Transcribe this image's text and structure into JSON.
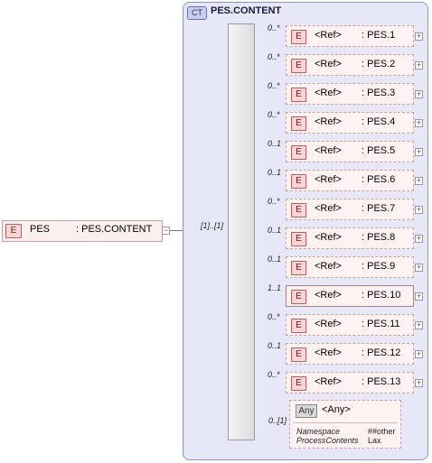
{
  "complex_type": {
    "badge": "CT",
    "name": "PES.CONTENT"
  },
  "root": {
    "badge": "E",
    "name": "PES",
    "type": ": PES.CONTENT",
    "cardinality": "[1]..[1]"
  },
  "children": [
    {
      "card": "0..*",
      "ref": "<Ref>",
      "name": ": PES.1"
    },
    {
      "card": "0..*",
      "ref": "<Ref>",
      "name": ": PES.2"
    },
    {
      "card": "0..*",
      "ref": "<Ref>",
      "name": ": PES.3"
    },
    {
      "card": "0..*",
      "ref": "<Ref>",
      "name": ": PES.4"
    },
    {
      "card": "0..1",
      "ref": "<Ref>",
      "name": ": PES.5"
    },
    {
      "card": "0..1",
      "ref": "<Ref>",
      "name": ": PES.6"
    },
    {
      "card": "0..*",
      "ref": "<Ref>",
      "name": ": PES.7"
    },
    {
      "card": "0..1",
      "ref": "<Ref>",
      "name": ": PES.8"
    },
    {
      "card": "0..1",
      "ref": "<Ref>",
      "name": ": PES.9"
    },
    {
      "card": "1..1",
      "ref": "<Ref>",
      "name": ": PES.10",
      "required": true
    },
    {
      "card": "0..*",
      "ref": "<Ref>",
      "name": ": PES.11"
    },
    {
      "card": "0..1",
      "ref": "<Ref>",
      "name": ": PES.12"
    },
    {
      "card": "0..*",
      "ref": "<Ref>",
      "name": ": PES.13"
    }
  ],
  "element_badge": "E",
  "any": {
    "badge": "Any",
    "name": "<Any>",
    "card": "0..[1]",
    "namespace_label": "Namespace",
    "namespace_value": "##other",
    "process_label": "ProcessContents",
    "process_value": "Lax"
  }
}
